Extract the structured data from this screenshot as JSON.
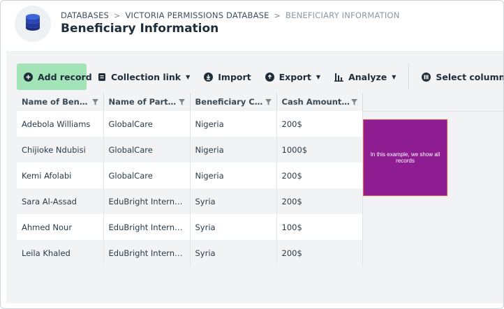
{
  "breadcrumb": {
    "items": [
      "DATABASES",
      "VICTORIA PERMISSIONS DATABASE",
      "BENEFICIARY INFORMATION"
    ]
  },
  "page_title": "Beneficiary Information",
  "toolbar": {
    "add_record": "Add record",
    "collection_link": "Collection link",
    "import": "Import",
    "export": "Export",
    "analyze": "Analyze",
    "select_columns": "Select columns"
  },
  "table": {
    "headers": [
      "Name of Benefi…",
      "Name of Partne…",
      "Beneficiary Cou…",
      "Cash Amount R…"
    ],
    "rows": [
      [
        "Adebola Williams",
        "GlobalCare",
        "Nigeria",
        "200$"
      ],
      [
        "Chijioke Ndubisi",
        "GlobalCare",
        "Nigeria",
        "1000$"
      ],
      [
        "Kemi Afolabi",
        "GlobalCare",
        "Nigeria",
        "200$"
      ],
      [
        "Sara Al-Assad",
        "EduBright Interna…",
        "Syria",
        "200$"
      ],
      [
        "Ahmed Nour",
        "EduBright Interna…",
        "Syria",
        "100$"
      ],
      [
        "Leila Khaled",
        "EduBright Interna…",
        "Syria",
        "200$"
      ]
    ]
  },
  "annotation": {
    "text": "In this example, we show all records"
  },
  "colors": {
    "add_button": "#a3e3b8",
    "annotation_bg": "#8e1d92",
    "annotation_border": "#e8584a",
    "database_icon": "#2b4fc4"
  }
}
